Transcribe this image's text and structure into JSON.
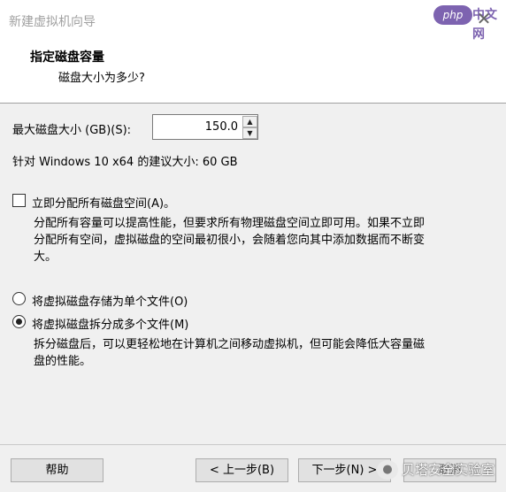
{
  "window": {
    "title": "新建虚拟机向导",
    "close_glyph": "✕"
  },
  "watermark_top": {
    "logo_text": "php",
    "suffix": "中文网"
  },
  "header": {
    "title": "指定磁盘容量",
    "subtitle": "磁盘大小为多少?"
  },
  "disk": {
    "max_label": "最大磁盘大小 (GB)(S):",
    "value": "150.0",
    "recommend": "针对 Windows 10 x64 的建议大小: 60 GB"
  },
  "allocate": {
    "label": "立即分配所有磁盘空间(A)。",
    "checked": false,
    "desc_lines": [
      "分配所有容量可以提高性能，但要求所有物理磁盘空间立即可用。如果不立即",
      "分配所有空间，虚拟磁盘的空间最初很小，会随着您向其中添加数据而不断变",
      "大。"
    ]
  },
  "storage": {
    "single_label": "将虚拟磁盘存储为单个文件(O)",
    "split_label": "将虚拟磁盘拆分成多个文件(M)",
    "selected": "split",
    "split_desc_lines": [
      "拆分磁盘后，可以更轻松地在计算机之间移动虚拟机，但可能会降低大容量磁",
      "盘的性能。"
    ]
  },
  "buttons": {
    "help": "帮助",
    "back": "< 上一步(B)",
    "next": "下一步(N) >",
    "cancel": "取消"
  },
  "watermark_bottom": {
    "text": "贝塔安全实验室"
  }
}
